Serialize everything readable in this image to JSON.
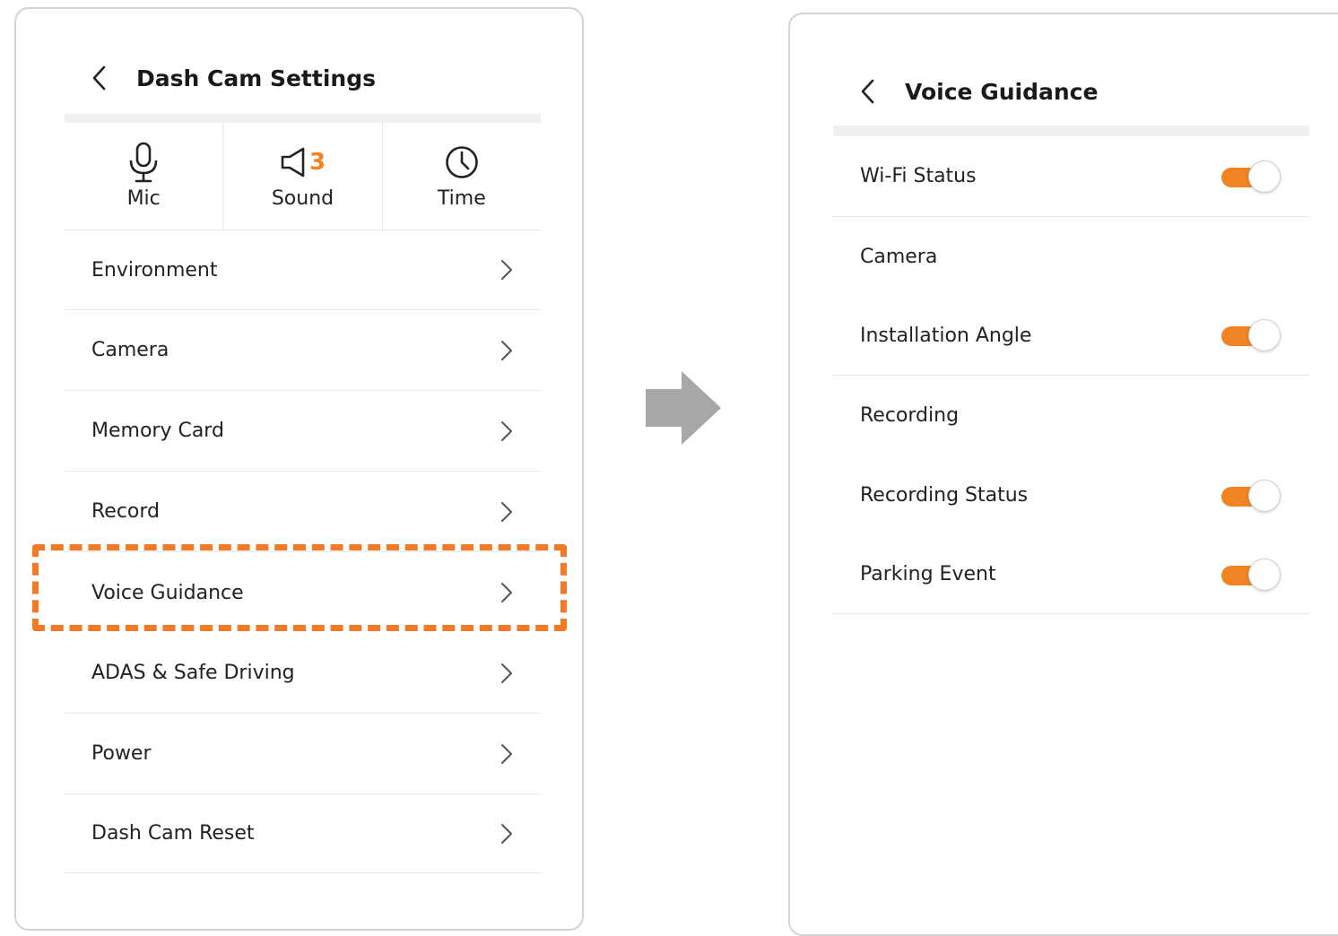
{
  "left_screen": {
    "title": "Dash Cam Settings",
    "quick_settings": [
      {
        "label": "Mic",
        "icon": "mic-icon"
      },
      {
        "label": "Sound",
        "icon": "speaker-icon",
        "value": "3"
      },
      {
        "label": "Time",
        "icon": "clock-icon"
      }
    ],
    "menu": [
      {
        "label": "Environment"
      },
      {
        "label": "Camera"
      },
      {
        "label": "Memory Card"
      },
      {
        "label": "Record"
      },
      {
        "label": "Voice Guidance",
        "highlighted": true
      },
      {
        "label": "ADAS & Safe Driving"
      },
      {
        "label": "Power"
      },
      {
        "label": "Dash Cam Reset"
      }
    ]
  },
  "right_screen": {
    "title": "Voice Guidance",
    "items": [
      {
        "label": "Wi-Fi Status",
        "toggle": true,
        "on": true
      },
      {
        "label": "Camera",
        "section": true
      },
      {
        "label": "Installation Angle",
        "toggle": true,
        "on": true
      },
      {
        "label": "Recording",
        "section": true
      },
      {
        "label": "Recording Status",
        "toggle": true,
        "on": true
      },
      {
        "label": "Parking Event",
        "toggle": true,
        "on": true
      }
    ]
  },
  "colors": {
    "accent": "#f08322",
    "highlight": "#f27a26",
    "arrow": "#a7a7a9",
    "divider": "#e6e6e6"
  }
}
